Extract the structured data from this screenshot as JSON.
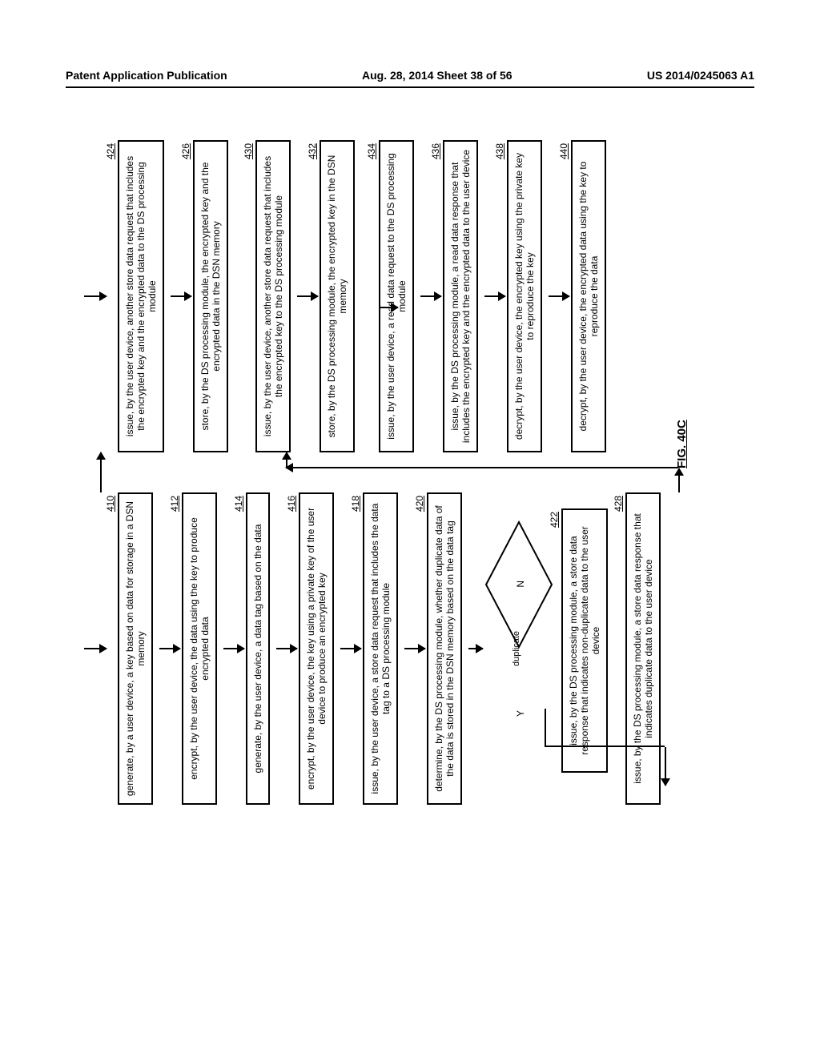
{
  "header": {
    "left": "Patent Application Publication",
    "center": "Aug. 28, 2014  Sheet 38 of 56",
    "right": "US 2014/0245063 A1"
  },
  "figure_label": "FIG. 40C",
  "diamond": {
    "text": "duplicate",
    "y_label": "Y",
    "n_label": "N"
  },
  "left_steps": [
    {
      "ref": "410",
      "text": "generate, by a user device, a key based on data for storage in a DSN memory"
    },
    {
      "ref": "412",
      "text": "encrypt, by the user device, the data using the key to produce encrypted data"
    },
    {
      "ref": "414",
      "text": "generate, by the user device, a data tag based on the data"
    },
    {
      "ref": "416",
      "text": "encrypt, by the user device, the key using a private key of the user device to produce an encrypted key"
    },
    {
      "ref": "418",
      "text": "issue, by the user device, a store data request that includes the data tag to a DS processing module"
    },
    {
      "ref": "420",
      "text": "determine, by the DS processing module, whether duplicate data of the data is stored in the DSN memory based on the data tag"
    },
    {
      "ref": "422",
      "text": "issue, by the DS processing module, a store data response that indicates non-duplicate data to the user device"
    },
    {
      "ref": "428",
      "text": "issue, by the DS processing module, a store data response that indicates duplicate data to the user device"
    }
  ],
  "right_steps": [
    {
      "ref": "424",
      "text": "issue, by the user device, another store data request that includes the encrypted key and the encrypted data to the DS processing module"
    },
    {
      "ref": "426",
      "text": "store, by the DS processing module, the encrypted key and the encrypted data in the DSN memory"
    },
    {
      "ref": "430",
      "text": "issue, by the user device, another store data request that includes the encrypted key to the DS processing module"
    },
    {
      "ref": "432",
      "text": "store, by the DS processing module, the encrypted key in the DSN memory"
    },
    {
      "ref": "434",
      "text": "issue, by the user device, a read data request to the DS processing module"
    },
    {
      "ref": "436",
      "text": "issue, by the DS processing module, a read data response that includes the encrypted key and the encrypted data to the user device"
    },
    {
      "ref": "438",
      "text": "decrypt, by the user device, the encrypted key using the private key to reproduce the key"
    },
    {
      "ref": "440",
      "text": "decrypt, by the user device, the encrypted data using the key to reproduce the data"
    }
  ]
}
